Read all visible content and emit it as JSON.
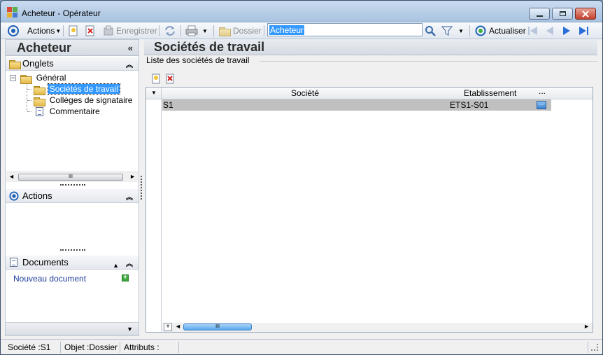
{
  "window": {
    "title": "Acheteur - Opérateur",
    "controls": [
      "minimize",
      "maximize",
      "close"
    ]
  },
  "toolbar": {
    "actions_label": "Actions",
    "save_label": "Enregistrer",
    "folder_label": "Dossier",
    "search_value": "Acheteur",
    "refresh_label": "Actualiser"
  },
  "left": {
    "title": "Acheteur",
    "onglets_label": "Onglets",
    "tree": {
      "root": "Général",
      "items": [
        "Sociétés de travail",
        "Collèges de signataire",
        "Commentaire"
      ]
    },
    "scroll_grip": "III",
    "actions_label": "Actions",
    "documents_label": "Documents",
    "new_document_label": "Nouveau document"
  },
  "main": {
    "title": "Sociétés de travail",
    "group_label": "Liste des sociétés de travail",
    "grid": {
      "columns": [
        "Société",
        "Etablissement",
        "..."
      ],
      "rows": [
        {
          "societe": "S1",
          "etablissement": "ETS1-S01"
        }
      ],
      "scroll_grip": "III"
    }
  },
  "status": {
    "societe": "Société :S1",
    "objet": "Objet :Dossier",
    "attributs": "Attributs :"
  },
  "colors": {
    "selection": "#3399ff",
    "row_selected": "#c0c0c0",
    "link": "#1f3f9a"
  }
}
